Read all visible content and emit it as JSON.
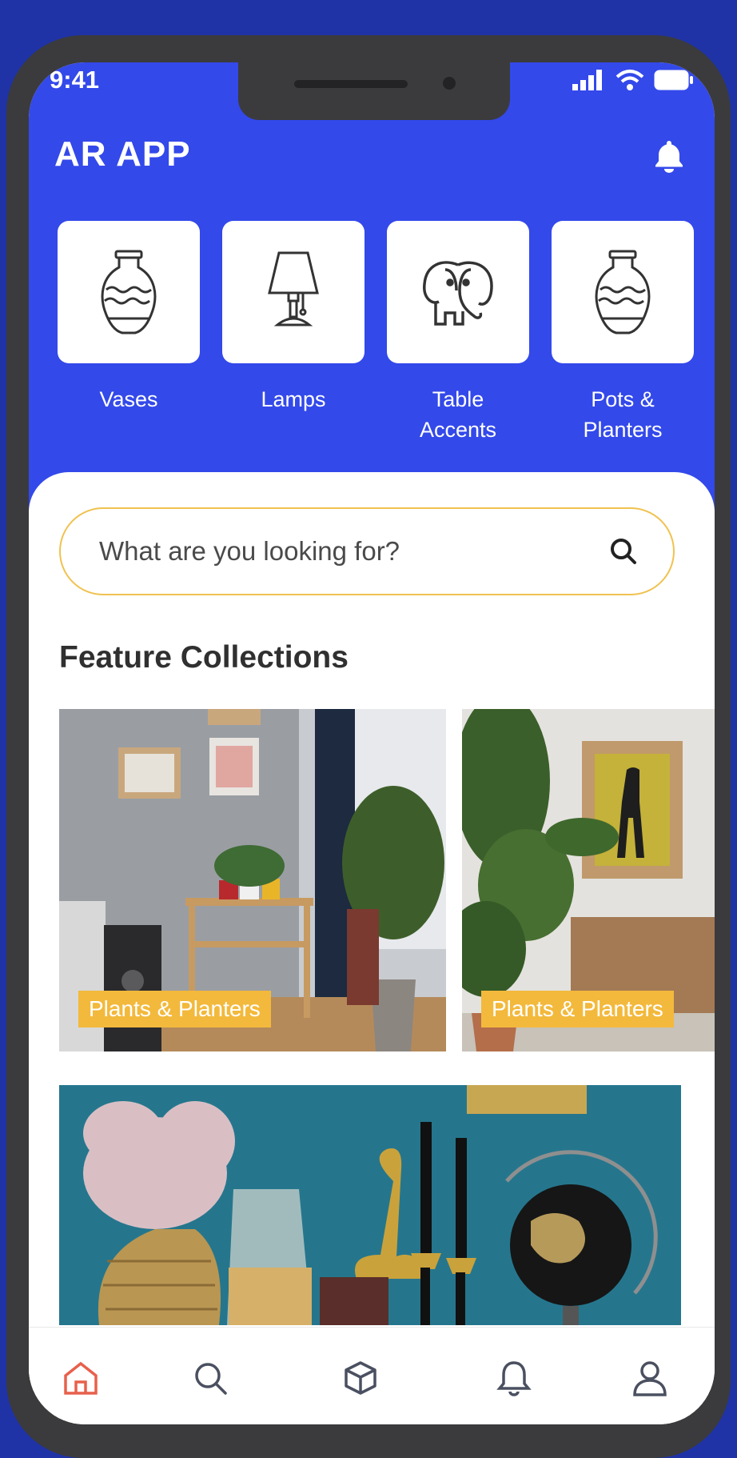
{
  "status_bar": {
    "time": "9:41"
  },
  "header": {
    "title": "AR APP"
  },
  "categories": [
    {
      "label": "Vases",
      "icon": "vase-icon"
    },
    {
      "label": "Lamps",
      "icon": "lamp-icon"
    },
    {
      "label": "Table\nAccents",
      "icon": "elephant-icon"
    },
    {
      "label": "Pots &\nPlanters",
      "icon": "vase-icon"
    }
  ],
  "search": {
    "placeholder": "What are you looking for?"
  },
  "section": {
    "title": "Feature Collections"
  },
  "collections": [
    {
      "tag": "Plants & Planters"
    },
    {
      "tag": "Plants & Planters"
    },
    {
      "tag": ""
    }
  ],
  "tabs": [
    {
      "icon": "home-icon",
      "active": true
    },
    {
      "icon": "search-icon",
      "active": false
    },
    {
      "icon": "cube-icon",
      "active": false
    },
    {
      "icon": "bell-icon",
      "active": false
    },
    {
      "icon": "user-icon",
      "active": false
    }
  ],
  "colors": {
    "primary": "#3349ea",
    "background": "#1f33a6",
    "accent": "#f3b93c",
    "active_tab": "#e8604c"
  }
}
